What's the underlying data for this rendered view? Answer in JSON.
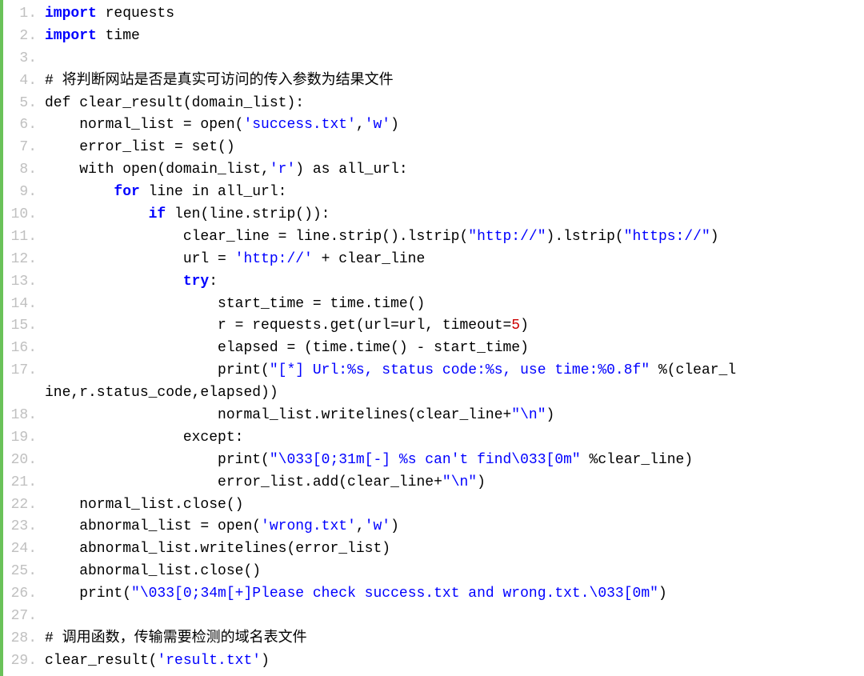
{
  "code": {
    "lines": [
      {
        "no": "1.",
        "segs": [
          {
            "t": "import",
            "c": "kw"
          },
          {
            "t": " requests",
            "c": "txt"
          }
        ]
      },
      {
        "no": "2.",
        "segs": [
          {
            "t": "import",
            "c": "kw"
          },
          {
            "t": " time",
            "c": "txt"
          }
        ]
      },
      {
        "no": "3.",
        "segs": [
          {
            "t": "",
            "c": "txt"
          }
        ]
      },
      {
        "no": "4.",
        "segs": [
          {
            "t": "# 将判断网站是否是真实可访问的传入参数为结果文件",
            "c": "cmt"
          }
        ]
      },
      {
        "no": "5.",
        "segs": [
          {
            "t": "def clear_result(domain_list):",
            "c": "txt"
          }
        ]
      },
      {
        "no": "6.",
        "segs": [
          {
            "t": "    normal_list = open(",
            "c": "txt"
          },
          {
            "t": "'success.txt'",
            "c": "str"
          },
          {
            "t": ",",
            "c": "txt"
          },
          {
            "t": "'w'",
            "c": "str"
          },
          {
            "t": ")",
            "c": "txt"
          }
        ]
      },
      {
        "no": "7.",
        "segs": [
          {
            "t": "    error_list = set()",
            "c": "txt"
          }
        ]
      },
      {
        "no": "8.",
        "segs": [
          {
            "t": "    with open(domain_list,",
            "c": "txt"
          },
          {
            "t": "'r'",
            "c": "str"
          },
          {
            "t": ") as all_url:",
            "c": "txt"
          }
        ]
      },
      {
        "no": "9.",
        "segs": [
          {
            "t": "        ",
            "c": "txt"
          },
          {
            "t": "for",
            "c": "kw"
          },
          {
            "t": " line in all_url:",
            "c": "txt"
          }
        ]
      },
      {
        "no": "10.",
        "segs": [
          {
            "t": "            ",
            "c": "txt"
          },
          {
            "t": "if",
            "c": "kw"
          },
          {
            "t": " len(line.strip()):",
            "c": "txt"
          }
        ]
      },
      {
        "no": "11.",
        "segs": [
          {
            "t": "                clear_line = line.strip().lstrip(",
            "c": "txt"
          },
          {
            "t": "\"http://\"",
            "c": "str"
          },
          {
            "t": ").lstrip(",
            "c": "txt"
          },
          {
            "t": "\"https://\"",
            "c": "str"
          },
          {
            "t": ")",
            "c": "txt"
          }
        ]
      },
      {
        "no": "12.",
        "segs": [
          {
            "t": "                url = ",
            "c": "txt"
          },
          {
            "t": "'http://'",
            "c": "str"
          },
          {
            "t": " + clear_line",
            "c": "txt"
          }
        ]
      },
      {
        "no": "13.",
        "segs": [
          {
            "t": "                ",
            "c": "txt"
          },
          {
            "t": "try",
            "c": "kw"
          },
          {
            "t": ":",
            "c": "txt"
          }
        ]
      },
      {
        "no": "14.",
        "segs": [
          {
            "t": "                    start_time = time.time()",
            "c": "txt"
          }
        ]
      },
      {
        "no": "15.",
        "segs": [
          {
            "t": "                    r = requests.get(url=url, timeout=",
            "c": "txt"
          },
          {
            "t": "5",
            "c": "num"
          },
          {
            "t": ")",
            "c": "txt"
          }
        ]
      },
      {
        "no": "16.",
        "segs": [
          {
            "t": "                    elapsed = (time.time() - start_time)",
            "c": "txt"
          }
        ]
      },
      {
        "no": "17.",
        "segs": [
          {
            "t": "                    print(",
            "c": "txt"
          },
          {
            "t": "\"[*] Url:%s, status code:%s, use time:%0.8f\"",
            "c": "str"
          },
          {
            "t": " %(clear_l",
            "c": "txt"
          }
        ]
      },
      {
        "no": "",
        "segs": [
          {
            "t": "ine,r.status_code,elapsed))",
            "c": "txt"
          }
        ]
      },
      {
        "no": "18.",
        "segs": [
          {
            "t": "                    normal_list.writelines(clear_line+",
            "c": "txt"
          },
          {
            "t": "\"\\n\"",
            "c": "str"
          },
          {
            "t": ")",
            "c": "txt"
          }
        ]
      },
      {
        "no": "19.",
        "segs": [
          {
            "t": "                except:",
            "c": "txt"
          }
        ]
      },
      {
        "no": "20.",
        "segs": [
          {
            "t": "                    print(",
            "c": "txt"
          },
          {
            "t": "\"\\033[0;31m[-] %s can't find\\033[0m\"",
            "c": "str"
          },
          {
            "t": " %clear_line)",
            "c": "txt"
          }
        ]
      },
      {
        "no": "21.",
        "segs": [
          {
            "t": "                    error_list.add(clear_line+",
            "c": "txt"
          },
          {
            "t": "\"\\n\"",
            "c": "str"
          },
          {
            "t": ")",
            "c": "txt"
          }
        ]
      },
      {
        "no": "22.",
        "segs": [
          {
            "t": "    normal_list.close()",
            "c": "txt"
          }
        ]
      },
      {
        "no": "23.",
        "segs": [
          {
            "t": "    abnormal_list = open(",
            "c": "txt"
          },
          {
            "t": "'wrong.txt'",
            "c": "str"
          },
          {
            "t": ",",
            "c": "txt"
          },
          {
            "t": "'w'",
            "c": "str"
          },
          {
            "t": ")",
            "c": "txt"
          }
        ]
      },
      {
        "no": "24.",
        "segs": [
          {
            "t": "    abnormal_list.writelines(error_list)",
            "c": "txt"
          }
        ]
      },
      {
        "no": "25.",
        "segs": [
          {
            "t": "    abnormal_list.close()",
            "c": "txt"
          }
        ]
      },
      {
        "no": "26.",
        "segs": [
          {
            "t": "    print(",
            "c": "txt"
          },
          {
            "t": "\"\\033[0;34m[+]Please check success.txt and wrong.txt.\\033[0m\"",
            "c": "str"
          },
          {
            "t": ")",
            "c": "txt"
          }
        ]
      },
      {
        "no": "27.",
        "segs": [
          {
            "t": "",
            "c": "txt"
          }
        ]
      },
      {
        "no": "28.",
        "segs": [
          {
            "t": "# 调用函数，传输需要检测的域名表文件",
            "c": "cmt"
          }
        ]
      },
      {
        "no": "29.",
        "segs": [
          {
            "t": "clear_result(",
            "c": "txt"
          },
          {
            "t": "'result.txt'",
            "c": "str"
          },
          {
            "t": ")",
            "c": "txt"
          }
        ]
      }
    ]
  }
}
